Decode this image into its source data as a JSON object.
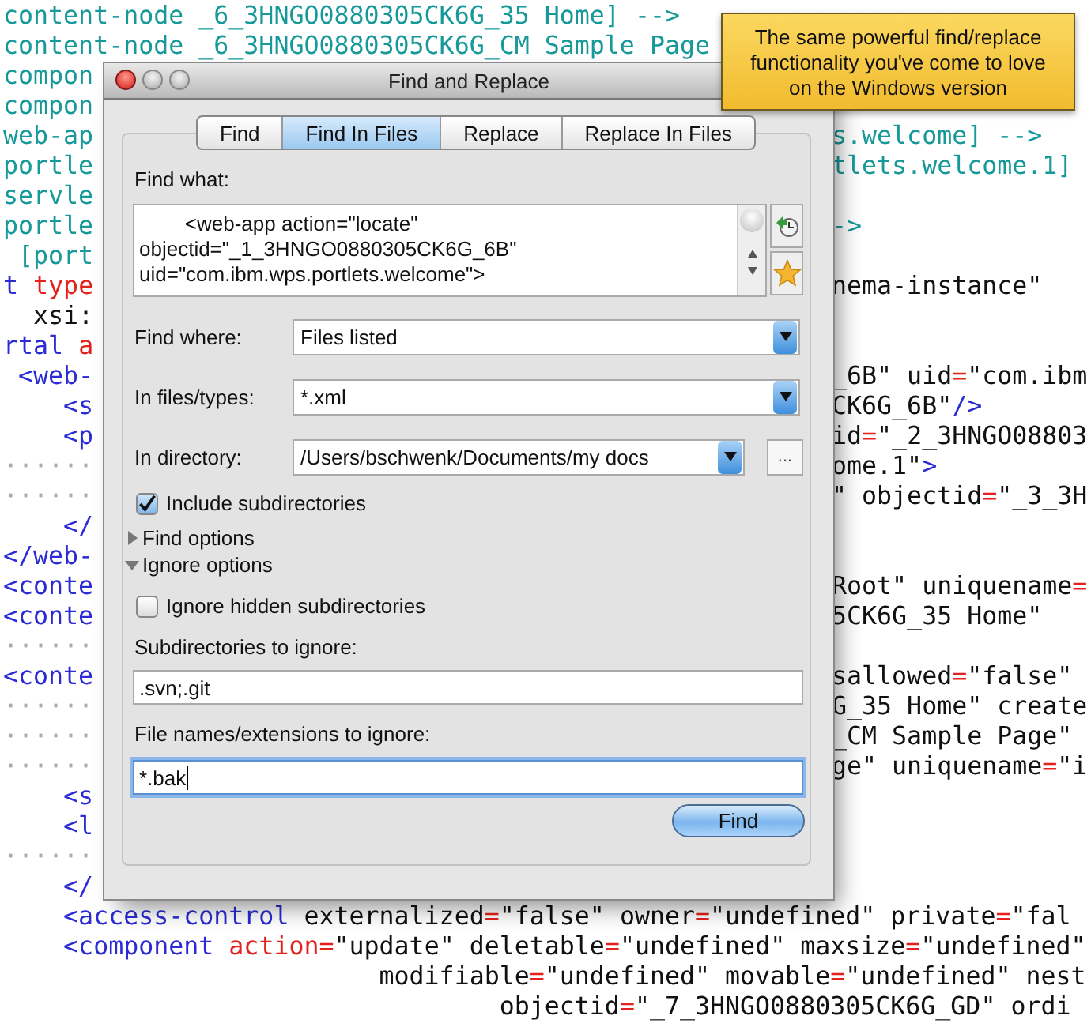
{
  "editor": {
    "lines": [
      {
        "left": [
          {
            "kind": "comment",
            "text": "content-node _6_3HNGO0880305CK6G_35 Home] -->"
          }
        ]
      },
      {
        "left": [
          {
            "kind": "comment",
            "text": "content-node _6_3HNGO0880305CK6G_CM Sample Page"
          }
        ]
      },
      {
        "left": [
          {
            "kind": "comment",
            "text": "compon"
          }
        ]
      },
      {
        "left": [
          {
            "kind": "comment",
            "text": "compon"
          }
        ]
      },
      {
        "left": [
          {
            "kind": "comment",
            "text": "web-ap"
          }
        ],
        "right": [
          {
            "kind": "comment",
            "text": "s.welcome] -->"
          }
        ]
      },
      {
        "left": [
          {
            "kind": "comment",
            "text": "portle"
          }
        ],
        "right": [
          {
            "kind": "comment",
            "text": "tlets.welcome.1]"
          }
        ]
      },
      {
        "left": [
          {
            "kind": "comment",
            "text": "servle"
          }
        ]
      },
      {
        "left": [
          {
            "kind": "comment",
            "text": "portle"
          }
        ],
        "right": [
          {
            "kind": "comment",
            "text": "->"
          }
        ]
      },
      {
        "left": [
          {
            "kind": "comment",
            "text": " [port"
          }
        ]
      },
      {
        "left": [
          {
            "kind": "tag",
            "text": "t "
          },
          {
            "kind": "attr",
            "text": "type"
          }
        ],
        "right": [
          {
            "kind": "text",
            "text": "nema-instance\""
          }
        ]
      },
      {
        "left": [
          {
            "kind": "text",
            "text": "  xsi:"
          }
        ]
      },
      {
        "left": [
          {
            "kind": "tag",
            "text": "rtal "
          },
          {
            "kind": "attr",
            "text": "a"
          }
        ]
      },
      {
        "left": [
          {
            "kind": "tag",
            "text": " <web-"
          }
        ],
        "right": [
          {
            "kind": "text",
            "text": "_6B\" uid"
          },
          {
            "kind": "attr",
            "text": "="
          },
          {
            "kind": "text",
            "text": "\"com.ibm"
          }
        ]
      },
      {
        "left": [
          {
            "kind": "tag",
            "text": "    <s"
          }
        ],
        "right": [
          {
            "kind": "text",
            "text": "CK6G_6B\""
          },
          {
            "kind": "tag",
            "text": "/>"
          }
        ]
      },
      {
        "left": [
          {
            "kind": "tag",
            "text": "    <p"
          }
        ],
        "right": [
          {
            "kind": "text",
            "text": "id"
          },
          {
            "kind": "attr",
            "text": "="
          },
          {
            "kind": "text",
            "text": "\"_2_3HNGO08803"
          }
        ]
      },
      {
        "left": [
          {
            "kind": "space",
            "text": "······"
          }
        ],
        "right": [
          {
            "kind": "text",
            "text": "ome.1\""
          },
          {
            "kind": "tag",
            "text": ">"
          }
        ]
      },
      {
        "left": [
          {
            "kind": "space",
            "text": "······"
          }
        ],
        "right": [
          {
            "kind": "text",
            "text": "\" objectid"
          },
          {
            "kind": "attr",
            "text": "="
          },
          {
            "kind": "text",
            "text": "\"_3_3H"
          }
        ]
      },
      {
        "left": [
          {
            "kind": "tag",
            "text": "    </"
          }
        ]
      },
      {
        "left": [
          {
            "kind": "tag",
            "text": "</web-"
          }
        ]
      },
      {
        "left": [
          {
            "kind": "tag",
            "text": "<conte"
          }
        ],
        "right": [
          {
            "kind": "text",
            "text": "Root\" uniquename"
          },
          {
            "kind": "attr",
            "text": "="
          }
        ]
      },
      {
        "left": [
          {
            "kind": "tag",
            "text": "<conte"
          }
        ],
        "right": [
          {
            "kind": "text",
            "text": "5CK6G_35 Home\""
          }
        ]
      },
      {
        "left": [
          {
            "kind": "space",
            "text": "······"
          }
        ]
      },
      {
        "left": [
          {
            "kind": "tag",
            "text": "<conte"
          }
        ],
        "right": [
          {
            "kind": "text",
            "text": "sallowed"
          },
          {
            "kind": "attr",
            "text": "="
          },
          {
            "kind": "text",
            "text": "\"false\""
          }
        ]
      },
      {
        "left": [
          {
            "kind": "space",
            "text": "······"
          }
        ],
        "right": [
          {
            "kind": "text",
            "text": "G_35 Home\" create"
          }
        ]
      },
      {
        "left": [
          {
            "kind": "space",
            "text": "······"
          }
        ],
        "right": [
          {
            "kind": "text",
            "text": "_CM Sample Page\""
          }
        ]
      },
      {
        "left": [
          {
            "kind": "space",
            "text": "······"
          }
        ],
        "right": [
          {
            "kind": "text",
            "text": "ge\" uniquename"
          },
          {
            "kind": "attr",
            "text": "="
          },
          {
            "kind": "text",
            "text": "\"i"
          }
        ]
      },
      {
        "left": [
          {
            "kind": "tag",
            "text": "    <s"
          }
        ]
      },
      {
        "left": [
          {
            "kind": "tag",
            "text": "    <l"
          }
        ]
      },
      {
        "left": [
          {
            "kind": "space",
            "text": "······"
          }
        ]
      },
      {
        "left": [
          {
            "kind": "tag",
            "text": "    </"
          }
        ]
      },
      {
        "left": [
          {
            "kind": "tag",
            "text": "    <access-control"
          },
          {
            "kind": "text",
            "text": " externalized"
          },
          {
            "kind": "attr",
            "text": "="
          },
          {
            "kind": "text",
            "text": "\"false\" owner"
          },
          {
            "kind": "attr",
            "text": "="
          },
          {
            "kind": "text",
            "text": "\"undefined\" private"
          },
          {
            "kind": "attr",
            "text": "="
          },
          {
            "kind": "text",
            "text": "\"fal"
          }
        ]
      },
      {
        "left": [
          {
            "kind": "tag",
            "text": "    <component"
          },
          {
            "kind": "attr",
            "text": " action="
          },
          {
            "kind": "text",
            "text": "\"update\" deletable"
          },
          {
            "kind": "attr",
            "text": "="
          },
          {
            "kind": "text",
            "text": "\"undefined\" maxsize"
          },
          {
            "kind": "attr",
            "text": "="
          },
          {
            "kind": "text",
            "text": "\"undefined\""
          }
        ]
      },
      {
        "left": [
          {
            "kind": "text",
            "text": "                         modifiable"
          },
          {
            "kind": "attr",
            "text": "="
          },
          {
            "kind": "text",
            "text": "\"undefined\" movable"
          },
          {
            "kind": "attr",
            "text": "="
          },
          {
            "kind": "text",
            "text": "\"undefined\" nest"
          }
        ]
      },
      {
        "left": [
          {
            "kind": "text",
            "text": "                                 objectid"
          },
          {
            "kind": "attr",
            "text": "="
          },
          {
            "kind": "text",
            "text": "\"_7_3HNGO0880305CK6G_GD\" ordi"
          }
        ]
      }
    ]
  },
  "dialog": {
    "title": "Find and Replace",
    "tabs": [
      {
        "label": "Find",
        "selected": false
      },
      {
        "label": "Find In Files",
        "selected": true
      },
      {
        "label": "Replace",
        "selected": false
      },
      {
        "label": "Replace In Files",
        "selected": false
      }
    ],
    "find_what": {
      "label": "Find what:",
      "value": "        <web-app action=\"locate\"\nobjectid=\"_1_3HNGO0880305CK6G_6B\"\nuid=\"com.ibm.wps.portlets.welcome\">"
    },
    "find_where": {
      "label": "Find where:",
      "value": "Files listed"
    },
    "files_types": {
      "label": "In files/types:",
      "value": "*.xml"
    },
    "directory": {
      "label": "In directory:",
      "value": "/Users/bschwenk/Documents/my docs",
      "browse_button": "..."
    },
    "include_subdirectories": {
      "label": "Include subdirectories",
      "checked": true
    },
    "sections": [
      {
        "label": "Find options",
        "expanded": false
      },
      {
        "label": "Ignore options",
        "expanded": true
      }
    ],
    "ignore_hidden": {
      "label": "Ignore hidden subdirectories",
      "checked": false
    },
    "subdirectories_to_ignore": {
      "label": "Subdirectories to ignore:",
      "value": ".svn;.git"
    },
    "names_to_ignore": {
      "label": "File names/extensions to ignore:",
      "value": "*.bak",
      "focused": true
    },
    "find_button": "Find"
  },
  "tooltip": {
    "text": "The same powerful find/replace functionality you've come to love on the Windows version"
  }
}
